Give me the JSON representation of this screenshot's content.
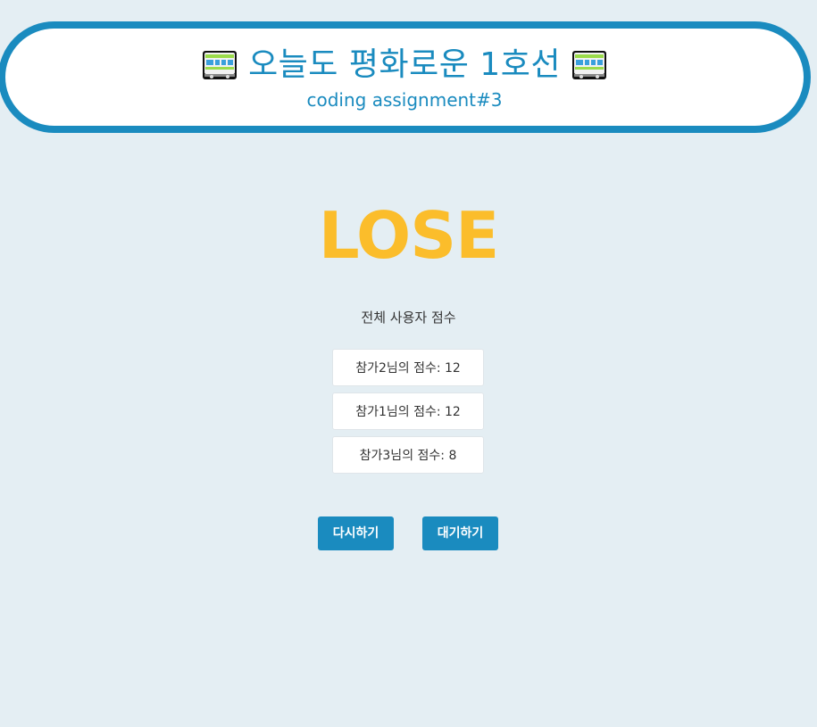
{
  "header": {
    "title": "오늘도 평화로운 1호선",
    "subtitle": "coding assignment#3",
    "icon_left": "train-icon",
    "icon_right": "train-icon"
  },
  "result": {
    "label": "LOSE",
    "color": "#fbbd2b"
  },
  "scores": {
    "heading": "전체 사용자 점수",
    "items": [
      "참가2님의 점수: 12",
      "참가1님의 점수: 12",
      "참가3님의 점수: 8"
    ]
  },
  "actions": {
    "restart_label": "다시하기",
    "wait_label": "대기하기"
  },
  "colors": {
    "accent": "#1a8bbf",
    "background": "#e4eef3",
    "result": "#fbbd2b"
  }
}
